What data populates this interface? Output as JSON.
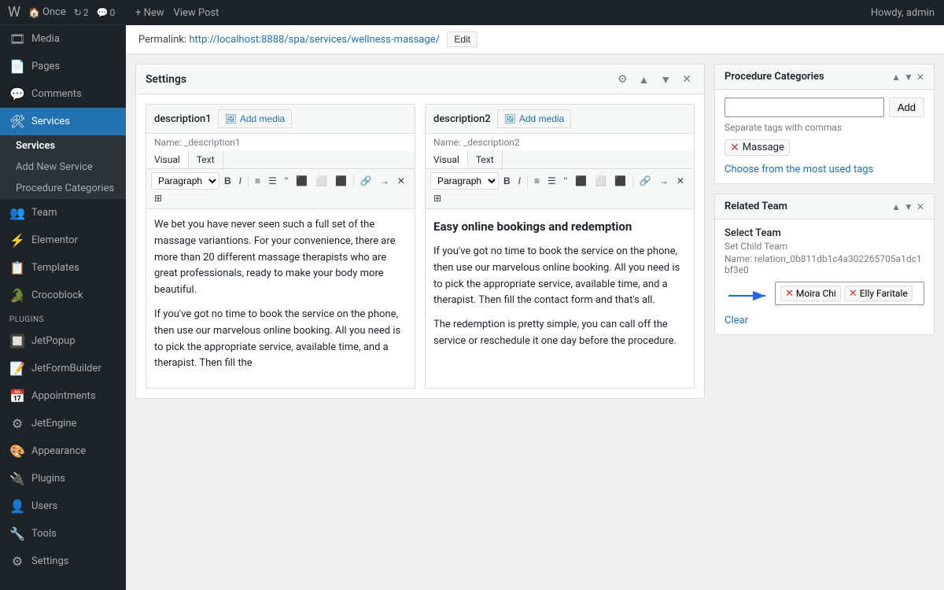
{
  "topbar": {
    "wp_icon": "W",
    "site_name": "Once",
    "updates_count": "2",
    "comments_count": "0",
    "new_label": "+ New",
    "view_post_label": "View Post",
    "howdy_label": "Howdy, admin"
  },
  "sidebar": {
    "items": [
      {
        "id": "media",
        "label": "Media",
        "icon": "🎞"
      },
      {
        "id": "pages",
        "label": "Pages",
        "icon": "📄"
      },
      {
        "id": "comments",
        "label": "Comments",
        "icon": "💬"
      },
      {
        "id": "services",
        "label": "Services",
        "icon": "🛠",
        "active": true
      }
    ],
    "services_submenu": [
      {
        "id": "services-list",
        "label": "Services"
      },
      {
        "id": "add-new-service",
        "label": "Add New Service"
      },
      {
        "id": "procedure-categories",
        "label": "Procedure Categories"
      }
    ],
    "team_item": {
      "label": "Team",
      "icon": "👥"
    },
    "elementor_item": {
      "label": "Elementor",
      "icon": "⚡"
    },
    "templates_item": {
      "label": "Templates",
      "icon": "📋"
    },
    "crocoblock_item": {
      "label": "Crocoblock",
      "icon": "🐊"
    },
    "plugins_label": "PLUGINS",
    "jetpopup_item": {
      "label": "JetPopup",
      "icon": "🔲"
    },
    "jetformbuilder_item": {
      "label": "JetFormBuilder",
      "icon": "📝"
    },
    "appointments_item": {
      "label": "Appointments",
      "icon": "📅"
    },
    "jetengine_item": {
      "label": "JetEngine",
      "icon": "⚙"
    },
    "appearance_item": {
      "label": "Appearance",
      "icon": "🎨"
    },
    "plugins_item": {
      "label": "Plugins",
      "icon": "🔌"
    },
    "users_item": {
      "label": "Users",
      "icon": "👤"
    },
    "tools_item": {
      "label": "Tools",
      "icon": "🔧"
    },
    "settings_item": {
      "label": "Settings",
      "icon": "⚙"
    }
  },
  "permalink": {
    "label": "Permalink:",
    "url": "http://localhost:8888/spa/services/wellness-massage/",
    "edit_label": "Edit"
  },
  "settings": {
    "title": "Settings",
    "description1": {
      "label": "description1",
      "add_media": "Add media",
      "name_label": "Name:",
      "name_value": "_description1",
      "tab_visual": "Visual",
      "tab_text": "Text",
      "paragraph_option": "Paragraph",
      "content_p1": "We bet you have never seen such a full set of the massage variantions. For your convenience, there are more than 20 different massage therapists who are great professionals, ready to make your body more beautiful.",
      "content_p2": "If you've got no time to book the service on the phone, then use our marvelous online booking. All you need is to pick the appropriate service, available time, and a therapist. Then fill the"
    },
    "description2": {
      "label": "description2",
      "add_media": "Add media",
      "name_label": "Name:",
      "name_value": "_description2",
      "tab_visual": "Visual",
      "tab_text": "Text",
      "paragraph_option": "Paragraph",
      "bold_heading": "Easy online bookings and redemption",
      "content_p1": "If you've got no time to book the service on the phone, then use our marvelous online booking. All you need is to pick the appropriate service, available time, and a therapist. Then fill the contact form and that's all.",
      "content_p2": "The redemption is pretty simple, you can call off the service or reschedule it one day before the procedure."
    }
  },
  "procedure_categories": {
    "title": "Procedure Categories",
    "input_placeholder": "",
    "add_label": "Add",
    "hint": "Separate tags with commas",
    "tags": [
      {
        "label": "Massage"
      }
    ],
    "choose_tags_label": "Choose from the most used tags"
  },
  "related_team": {
    "title": "Related Team",
    "select_team_label": "Select Team",
    "set_child_label": "Set Child Team",
    "name_label": "Name:",
    "name_value": "relation_0b811db1c4a302265705a1dc1bf3e0",
    "team_members": [
      {
        "label": "Moira Chi"
      },
      {
        "label": "Elly Faritale"
      }
    ],
    "clear_label": "Clear"
  },
  "toolbar_buttons": {
    "bold": "B",
    "italic": "I",
    "ol": "ol",
    "ul": "ul",
    "quote": "\"",
    "align_left": "≡",
    "align_center": "≡",
    "align_right": "≡",
    "link": "🔗",
    "indent": "→",
    "special": "✕",
    "table": "⊞"
  }
}
